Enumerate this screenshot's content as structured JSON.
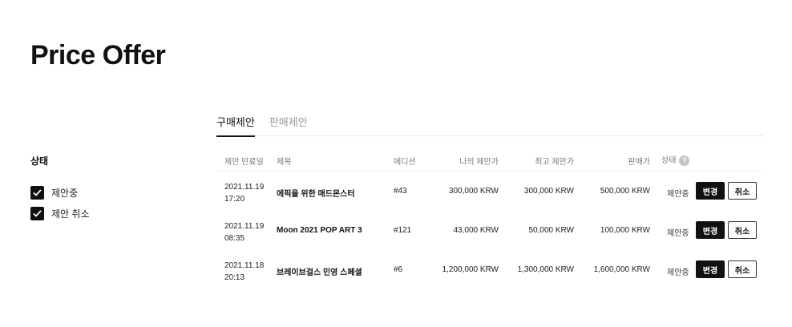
{
  "page": {
    "title": "Price Offer"
  },
  "filter": {
    "title": "상태",
    "options": [
      {
        "label": "제안중",
        "checked": true
      },
      {
        "label": "제안 취소",
        "checked": true
      }
    ]
  },
  "tabs": [
    {
      "label": "구매제안",
      "active": true
    },
    {
      "label": "판매제안",
      "active": false
    }
  ],
  "table": {
    "headers": {
      "expiry": "제안 만료일",
      "title": "제목",
      "edition": "에디션",
      "my_offer": "나의 제안가",
      "top_offer": "최고 제안가",
      "sell_price": "판매가",
      "status": "상태"
    },
    "rows": [
      {
        "date": "2021.11.19",
        "time": "17:20",
        "title": "에픽을 위한 매드몬스터",
        "edition": "#43",
        "my_offer": "300,000 KRW",
        "top_offer": "300,000 KRW",
        "sell_price": "500,000 KRW",
        "status": "제안중",
        "change": "변경",
        "cancel": "취소"
      },
      {
        "date": "2021.11.19",
        "time": "08:35",
        "title": "Moon 2021 POP ART 3",
        "edition": "#121",
        "my_offer": "43,000 KRW",
        "top_offer": "50,000 KRW",
        "sell_price": "100,000 KRW",
        "status": "제안중",
        "change": "변경",
        "cancel": "취소"
      },
      {
        "date": "2021.11.18",
        "time": "20:13",
        "title": "브레이브걸스 민영 스페셜",
        "edition": "#6",
        "my_offer": "1,200,000 KRW",
        "top_offer": "1,300,000 KRW",
        "sell_price": "1,600,000 KRW",
        "status": "제안중",
        "change": "변경",
        "cancel": "취소"
      }
    ]
  },
  "icons": {
    "help": "?"
  }
}
